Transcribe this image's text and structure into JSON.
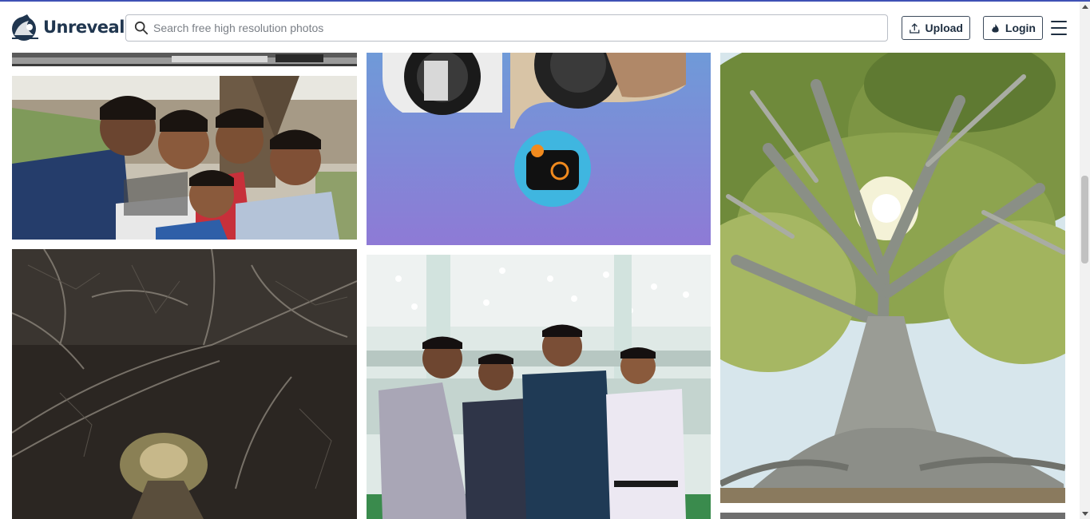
{
  "app": {
    "name": "Unreveal"
  },
  "search": {
    "placeholder": "Search free high resolution photos",
    "value": ""
  },
  "header": {
    "upload_label": "Upload",
    "login_label": "Login"
  },
  "icons": {
    "logo": "reveal-logo-icon",
    "search": "search-icon",
    "upload": "upload-icon",
    "login": "flame-icon",
    "menu": "hamburger-menu-icon"
  },
  "colors": {
    "accent_line": "#3f51b5",
    "brand_text": "#20364f"
  },
  "gallery": {
    "columns": 3,
    "photos": [
      {
        "subject": "black and white street scene (partially cropped)"
      },
      {
        "subject": "selfie of five young men in a field under a tree"
      },
      {
        "subject": "dark tunnel of twisted tree branches"
      },
      {
        "subject": "camera lenses with orange camera app icon on purple gradient"
      },
      {
        "subject": "four young men posing in a white hall with chandeliers"
      },
      {
        "subject": "large fig tree with sun shining through branches"
      },
      {
        "subject": "grey image (partially cropped)"
      }
    ]
  }
}
